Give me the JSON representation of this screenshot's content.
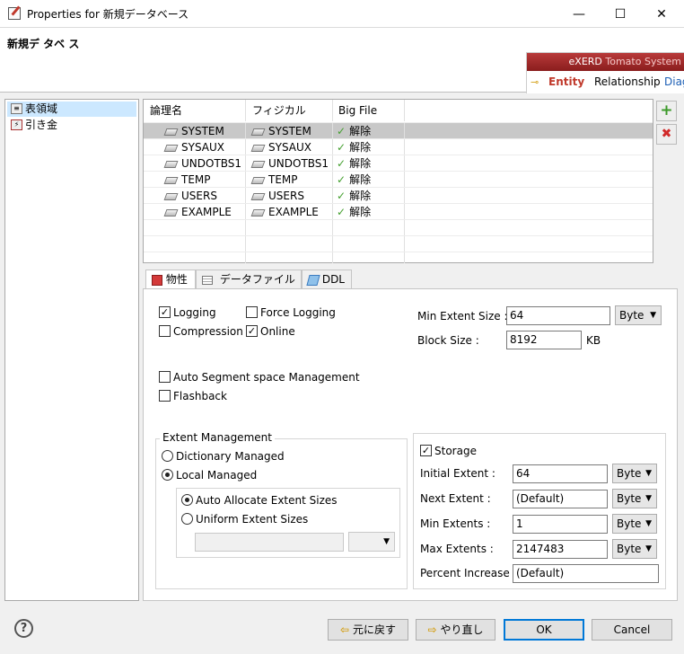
{
  "window": {
    "title": "Properties for 新規データベース",
    "minimize_label": "—",
    "maximize_label": "☐",
    "close_label": "✕"
  },
  "header": {
    "title": "新規デ タベ ス",
    "banner": {
      "brand": "eXERD",
      "brand_sub": "Tomato System",
      "tabs": [
        "Entity",
        "Relationship",
        "Diag"
      ]
    }
  },
  "tree": {
    "items": [
      {
        "label": "表領域",
        "selected": true
      },
      {
        "label": "引き金",
        "selected": false
      }
    ]
  },
  "table": {
    "columns": [
      "論理名",
      "フィジカル",
      "Big File"
    ],
    "rows": [
      {
        "logical": "SYSTEM",
        "physical": "SYSTEM",
        "bigfile": "解除"
      },
      {
        "logical": "SYSAUX",
        "physical": "SYSAUX",
        "bigfile": "解除"
      },
      {
        "logical": "UNDOTBS1",
        "physical": "UNDOTBS1",
        "bigfile": "解除"
      },
      {
        "logical": "TEMP",
        "physical": "TEMP",
        "bigfile": "解除"
      },
      {
        "logical": "USERS",
        "physical": "USERS",
        "bigfile": "解除"
      },
      {
        "logical": "EXAMPLE",
        "physical": "EXAMPLE",
        "bigfile": "解除"
      }
    ],
    "add_label": "+",
    "remove_label": "✖"
  },
  "tabs": [
    {
      "label": "物性",
      "active": true
    },
    {
      "label": "データファイル",
      "active": false
    },
    {
      "label": "DDL",
      "active": false
    }
  ],
  "props": {
    "logging": "Logging",
    "force_logging": "Force Logging",
    "compression": "Compression",
    "online": "Online",
    "min_extent_label": "Min Extent Size :",
    "min_extent_value": "64",
    "min_extent_unit": "Byte",
    "block_size_label": "Block Size :",
    "block_size_value": "8192",
    "block_size_unit": "KB",
    "auto_segment": "Auto Segment space Management",
    "flashback": "Flashback",
    "extent_mgmt": {
      "title": "Extent Management",
      "dictionary": "Dictionary Managed",
      "local": "Local Managed",
      "auto_allocate": "Auto Allocate Extent Sizes",
      "uniform": "Uniform Extent Sizes",
      "uniform_value": ""
    },
    "storage": {
      "title": "Storage",
      "initial_label": "Initial Extent :",
      "initial_value": "64",
      "initial_unit": "Byte",
      "next_label": "Next Extent :",
      "next_value": "(Default)",
      "next_unit": "Byte",
      "min_label": "Min Extents :",
      "min_value": "1",
      "min_unit": "Byte",
      "max_label": "Max Extents :",
      "max_value": "2147483",
      "max_unit": "Byte",
      "pct_label": "Percent Increase :",
      "pct_value": "(Default)"
    },
    "checks": {
      "logging": true,
      "force_logging": false,
      "compression": false,
      "online": true,
      "auto_segment": false,
      "flashback": false,
      "storage": true
    }
  },
  "footer": {
    "help": "?",
    "undo": "元に戻す",
    "redo": "やり直し",
    "ok": "OK",
    "cancel": "Cancel"
  }
}
